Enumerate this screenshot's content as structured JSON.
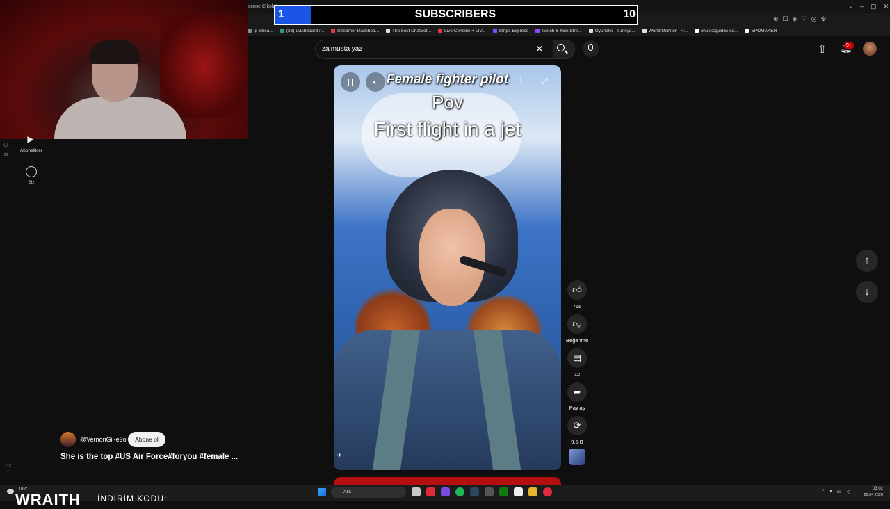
{
  "browser": {
    "tab_text": "erone Çikolat",
    "bookmarks": [
      {
        "label": "ig Strea...",
        "color": "#888888"
      },
      {
        "label": "(23) Dashboard /...",
        "color": "#2a9d8f"
      },
      {
        "label": "Streamer Dashboa...",
        "color": "#e63946"
      },
      {
        "label": "The best ChatBot...",
        "color": "#dddddd"
      },
      {
        "label": "Live Console + LIV...",
        "color": "#e63946"
      },
      {
        "label": "Stripe Express",
        "color": "#635bff"
      },
      {
        "label": "Twitch & Kick Stre...",
        "color": "#9146ff"
      },
      {
        "label": "Oyuneks - Türkiye...",
        "color": "#dddddd"
      },
      {
        "label": "World Monitor - R...",
        "color": "#dddddd"
      },
      {
        "label": "chucksguides.co...",
        "color": "#ffffff"
      },
      {
        "label": "EPOMAKER",
        "color": "#ffffff"
      }
    ]
  },
  "subscriber_goal": {
    "current": "1",
    "label": "SUBSCRIBERS",
    "goal": "10",
    "progress_fraction": 0.1,
    "fill_color": "#1a55e8"
  },
  "sidebar": {
    "subscriptions_label": "Abonelikler",
    "you_label": "Siz"
  },
  "search": {
    "value": "zaimusta yaz",
    "clear_icon": "close-icon",
    "search_icon": "search-icon",
    "mic_icon": "mic-icon"
  },
  "header": {
    "notification_badge": "9+",
    "upload_icon": "upload-icon",
    "bell_icon": "bell-icon"
  },
  "short": {
    "caption_line1": "Female fighter pilot",
    "caption_line2": "Pov",
    "caption_line3": "First flight in a jet",
    "like_count": "766",
    "dislike_label": "Beğenme",
    "comment_count": "12",
    "share_label": "Paylaş",
    "remix_count": "9,5 B",
    "channel_name": "@VernonGil-e9o",
    "subscribe_label": "Abone ol",
    "title": "She is the top #US Air Force#foryou #female ..."
  },
  "taskbar": {
    "search_placeholder": "Ara",
    "temperature": "10°C",
    "overlay_brand": "WRAITH",
    "overlay_promo": "İNDİRİM KODU:",
    "time": "03:02",
    "date": "26.04.2026"
  },
  "colors": {
    "background": "#0f0f0f",
    "accent_red": "#cc0000",
    "button_bg": "#272727"
  }
}
